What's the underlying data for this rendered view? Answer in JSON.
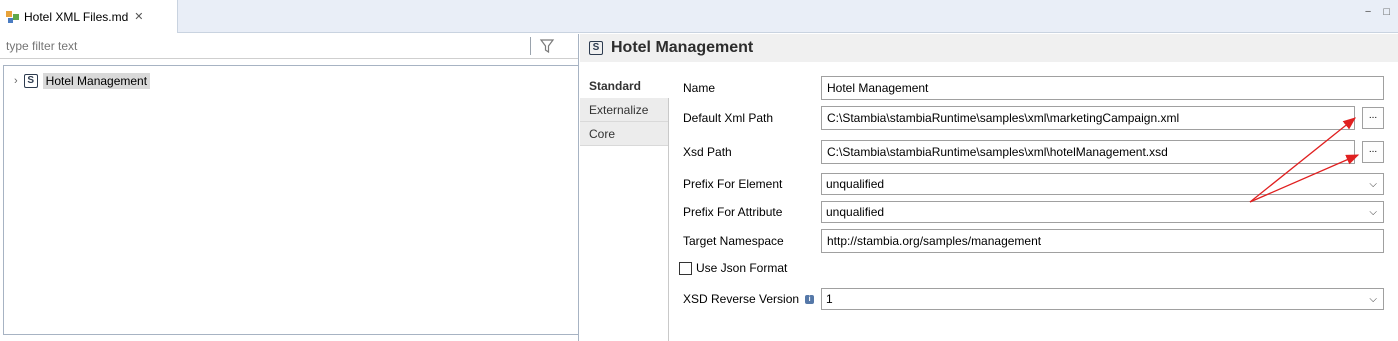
{
  "tab": {
    "title": "Hotel XML Files.md",
    "close_glyph": "✕"
  },
  "window_controls": {
    "minimize": "−",
    "maximize": "□"
  },
  "filter": {
    "placeholder": "type filter text"
  },
  "tree": {
    "items": [
      {
        "badge": "S",
        "label": "Hotel Management",
        "expand_glyph": "›"
      }
    ]
  },
  "editor": {
    "header": {
      "badge": "S",
      "title": "Hotel Management"
    },
    "tabs": [
      {
        "label": "Standard",
        "active": true
      },
      {
        "label": "Externalize",
        "active": false
      },
      {
        "label": "Core",
        "active": false
      }
    ],
    "fields": {
      "name": {
        "label": "Name",
        "value": "Hotel Management"
      },
      "default_xml_path": {
        "label": "Default Xml Path",
        "value": "C:\\Stambia\\stambiaRuntime\\samples\\xml\\marketingCampaign.xml",
        "button": "..."
      },
      "xsd_path": {
        "label": "Xsd Path",
        "value": "C:\\Stambia\\stambiaRuntime\\samples\\xml\\hotelManagement.xsd",
        "button": "..."
      },
      "prefix_element": {
        "label": "Prefix For Element",
        "value": "unqualified"
      },
      "prefix_attribute": {
        "label": "Prefix For Attribute",
        "value": "unqualified"
      },
      "target_namespace": {
        "label": "Target Namespace",
        "value": "http://stambia.org/samples/management"
      },
      "use_json": {
        "label": "Use Json Format",
        "checked": false
      },
      "xsd_reverse_version": {
        "label": "XSD Reverse Version",
        "value": "1",
        "info_glyph": "i"
      }
    }
  },
  "colors": {
    "tabbar_bg": "#e9eef7",
    "header_bg": "#f0f0f0",
    "annotation_arrow": "#e02020",
    "tree_selection": "#d9d9d9"
  },
  "icons": {
    "tab": "xml-file-icon",
    "filter": "funnel-icon",
    "tree_item": "schema-badge-icon",
    "dropdown": "chevron-down-icon"
  }
}
